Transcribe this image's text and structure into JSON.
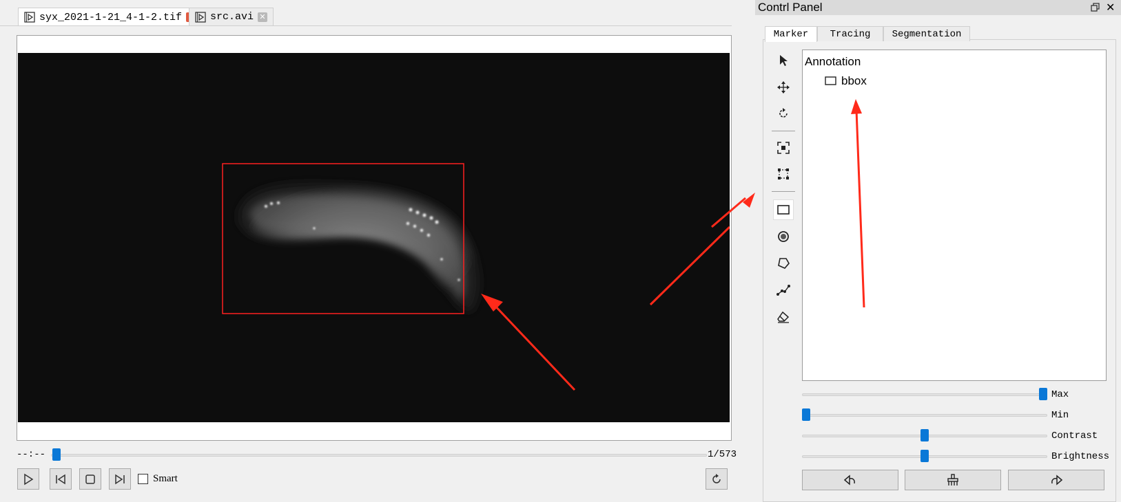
{
  "tabs": [
    {
      "label": "syx_2021-1-21_4-1-2.tif",
      "active": true
    },
    {
      "label": "src.avi",
      "active": false
    }
  ],
  "player": {
    "time": "--:--",
    "frame_counter": "1/573",
    "frame_fraction": 0.0017,
    "smart_label": "Smart",
    "smart_checked": false
  },
  "control_panel": {
    "title": "Contrl Panel",
    "tabs": [
      "Marker",
      "Tracing",
      "Segmentation"
    ],
    "active_tab": "Marker",
    "tools": [
      "cursor-icon",
      "move-icon",
      "rotate-icon",
      "fit-view-icon",
      "select-region-icon",
      "rectangle-icon",
      "circle-icon",
      "polygon-icon",
      "polyline-icon",
      "eraser-icon"
    ],
    "tree": {
      "root": "Annotation",
      "items": [
        {
          "label": "bbox",
          "icon": "rectangle-icon"
        }
      ]
    },
    "sliders": [
      {
        "label": "Max",
        "value": 1.0
      },
      {
        "label": "Min",
        "value": 0.0
      },
      {
        "label": "Contrast",
        "value": 0.5
      },
      {
        "label": "Brightness",
        "value": 0.5
      }
    ],
    "buttons": [
      "undo-icon",
      "clear-icon",
      "redo-icon"
    ]
  },
  "colors": {
    "accent": "#0a78d7",
    "annotation": "#ff2020",
    "tab_close": "#e05a40"
  }
}
